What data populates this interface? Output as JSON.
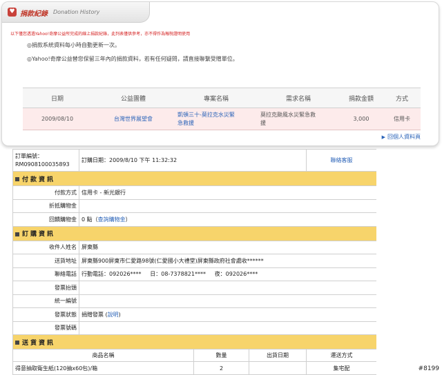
{
  "donation": {
    "title_zh": "捐款紀錄",
    "title_en": "Donation History",
    "notice_red": "以下僅您透過Yahoo!奇摩公益所完成的線上捐款紀錄，此列表僅供參考，亦不得作為報稅證明使用",
    "info": [
      "◎捐款系統資料每小時自動更新一次。",
      "◎Yahoo!奇摩公益替您保留三年內的捐款資料，若有任何疑問，請直接聯繫受贈單位。"
    ],
    "table": {
      "headers": [
        "日期",
        "公益團體",
        "專案名稱",
        "需求名稱",
        "捐款金額",
        "方式"
      ],
      "row": {
        "date": "2009/08/10",
        "org": "台灣世界展望會",
        "project_1": "凱頓三十-莫拉克水災緊",
        "project_2": "急救援",
        "need_1": "莫拉克颱風水災緊急救",
        "need_2": "援",
        "amount": "3,000",
        "method": "信用卡"
      }
    },
    "personal_link": "回個人資料頁"
  },
  "order": {
    "order_no_label": "訂單編號：",
    "order_no": "RM0908100035893",
    "order_date": "訂購日期：2009/8/10 下午 11:32:32",
    "contact_link": "聯絡客服",
    "payment_header": "付款資訊",
    "payment": {
      "method_label": "付款方式",
      "method_value": "信用卡 - 新光銀行",
      "discount_label": "折抵購物金",
      "discount_value": "",
      "rebate_label": "回饋購物金",
      "rebate_value": "0 點（",
      "rebate_link": "查詢購物金",
      "rebate_tail": "）"
    },
    "order_header": "訂購資訊",
    "info": {
      "recipient_label": "收件人姓名",
      "recipient_value": "屏東縣",
      "address_label": "送貨地址",
      "address_value": "屏東縣900屏東市仁愛路98號(仁愛國小大禮堂)屏東縣政府社會處收******",
      "phone_label": "聯絡電話",
      "phone_mobile": "行動電話：092026****",
      "phone_day": "日：08-7378821****",
      "phone_night": "夜：092026****",
      "invoice_title_label": "發票抬頭",
      "invoice_title_value": "",
      "tax_id_label": "統一編號",
      "tax_id_value": "",
      "invoice_status_label": "發票狀態",
      "invoice_status_value": "捐贈發票 (",
      "invoice_status_link": "說明",
      "invoice_status_tail": ")",
      "invoice_no_label": "發票號碼",
      "invoice_no_value": ""
    },
    "shipping_header": "送貨資訊",
    "shipping": {
      "columns": [
        "商品名稱",
        "數量",
        "出貨日期",
        "運送方式"
      ],
      "item_name": "得意抽取衛生紙(120抽x60包)/箱",
      "item_qty": "2",
      "item_date": "",
      "item_method": "集宅配"
    }
  },
  "badge": "#8199"
}
